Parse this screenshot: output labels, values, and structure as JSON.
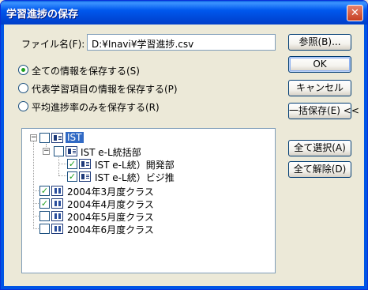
{
  "window": {
    "title": "学習進捗の保存",
    "close_glyph": "✕"
  },
  "filename": {
    "label": "ファイル名(F):",
    "value": "D:¥Inavi¥学習進捗.csv",
    "browse_label": "参照(B)..."
  },
  "buttons": {
    "ok": "OK",
    "cancel": "キャンセル",
    "bulk_save": "一括保存(E) <<",
    "select_all": "全て選択(A)",
    "deselect_all": "全て解除(D)"
  },
  "options": [
    {
      "label": "全ての情報を保存する(S)",
      "selected": true
    },
    {
      "label": "代表学習項目の情報を保存する(P)",
      "selected": false
    },
    {
      "label": "平均進捗率のみを保存する(R)",
      "selected": false
    }
  ],
  "tree": {
    "expander_open": "−",
    "check_mark": "✓",
    "nodes": [
      {
        "label": "IST",
        "checked": false,
        "selected": true
      },
      {
        "label": "IST e-L統括部",
        "checked": false,
        "selected": false
      },
      {
        "label": "IST e-L統）開発部",
        "checked": true,
        "selected": false
      },
      {
        "label": "IST e-L統）ビジ推",
        "checked": true,
        "selected": false
      },
      {
        "label": "2004年3月度クラス",
        "checked": true,
        "selected": false
      },
      {
        "label": "2004年4月度クラス",
        "checked": true,
        "selected": false
      },
      {
        "label": "2004年5月度クラス",
        "checked": false,
        "selected": false
      },
      {
        "label": "2004年6月度クラス",
        "checked": false,
        "selected": false
      }
    ]
  }
}
